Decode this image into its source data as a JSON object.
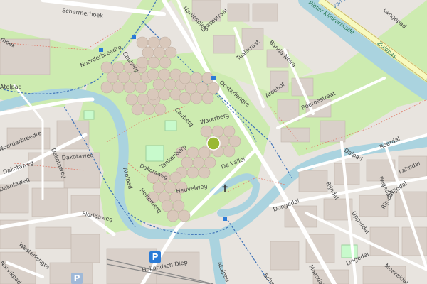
{
  "map": {
    "labels": {
      "schermerhoek": "Schermerhoek",
      "noordhoek_fragment": "rhoek",
      "noorderbreedte_1": "Noorderbreedte",
      "noorderbreedte_2": "Noorderbreedte",
      "cauberg": "Cauberg",
      "caubergh": "Cauberg",
      "oosterlengte": "Oosterlengte",
      "waterberg": "Waterberg",
      "dakotaweg_1": "Dakotaweg",
      "dakotaweg_2": "Dakotaweg",
      "dakotaweg_3": "Dakotaweg",
      "dakotaweg_4": "Dakotaweg",
      "floridaweg": "Floridaweg",
      "westerlengte": "Westerlengte",
      "narvikpad": "Narvikpad",
      "atolpad_1": "Atolpad",
      "atolpad_2": "Atolpad",
      "atolpad_3": "Atolpad",
      "heuvelweg": "Heuvelweg",
      "hofierberg": "Hofierberg",
      "tankenberg": "Tankenberg",
      "de_vallei": "De Vallei",
      "hollandsch_diep": "Hollandsch Diep",
      "naniesplein": "Naniesplein",
      "leasestraat": "Leasestraat",
      "tualstraat": "Tualstraat",
      "banda_neira": "Banda Neira",
      "aroehof": "Aroehof",
      "boeroestraat": "Boeroestraat",
      "pr_klinkert": "Pieter Klinkertkade",
      "van_den_ijssel": "van den IJssel",
      "langepad": "Langepad",
      "zuidpas": "Zuidpas",
      "dalpad": "Dalpad",
      "roerdal": "Roerdal",
      "lahndal": "Lahndal",
      "rijndal": "Rijndal",
      "regedal": "Regedal",
      "rijndal_2": "Rijndal",
      "dongedal": "Dongedal",
      "upperdal": "Upperdal",
      "lingedal": "Lingedal",
      "maasdal": "Maasdal",
      "moezeldal": "Moezeldal",
      "schemer": "Sche"
    },
    "symbols": {
      "parking": "P",
      "parking_2": "P",
      "church": "✝"
    },
    "colors": {
      "water": "#aad3df",
      "park": "#c8facc",
      "grass": "#cdebb0",
      "building": "#d9d0c9",
      "road": "#ffffff",
      "highway": "#f7fabf",
      "cycle": "#3f73b8"
    }
  }
}
